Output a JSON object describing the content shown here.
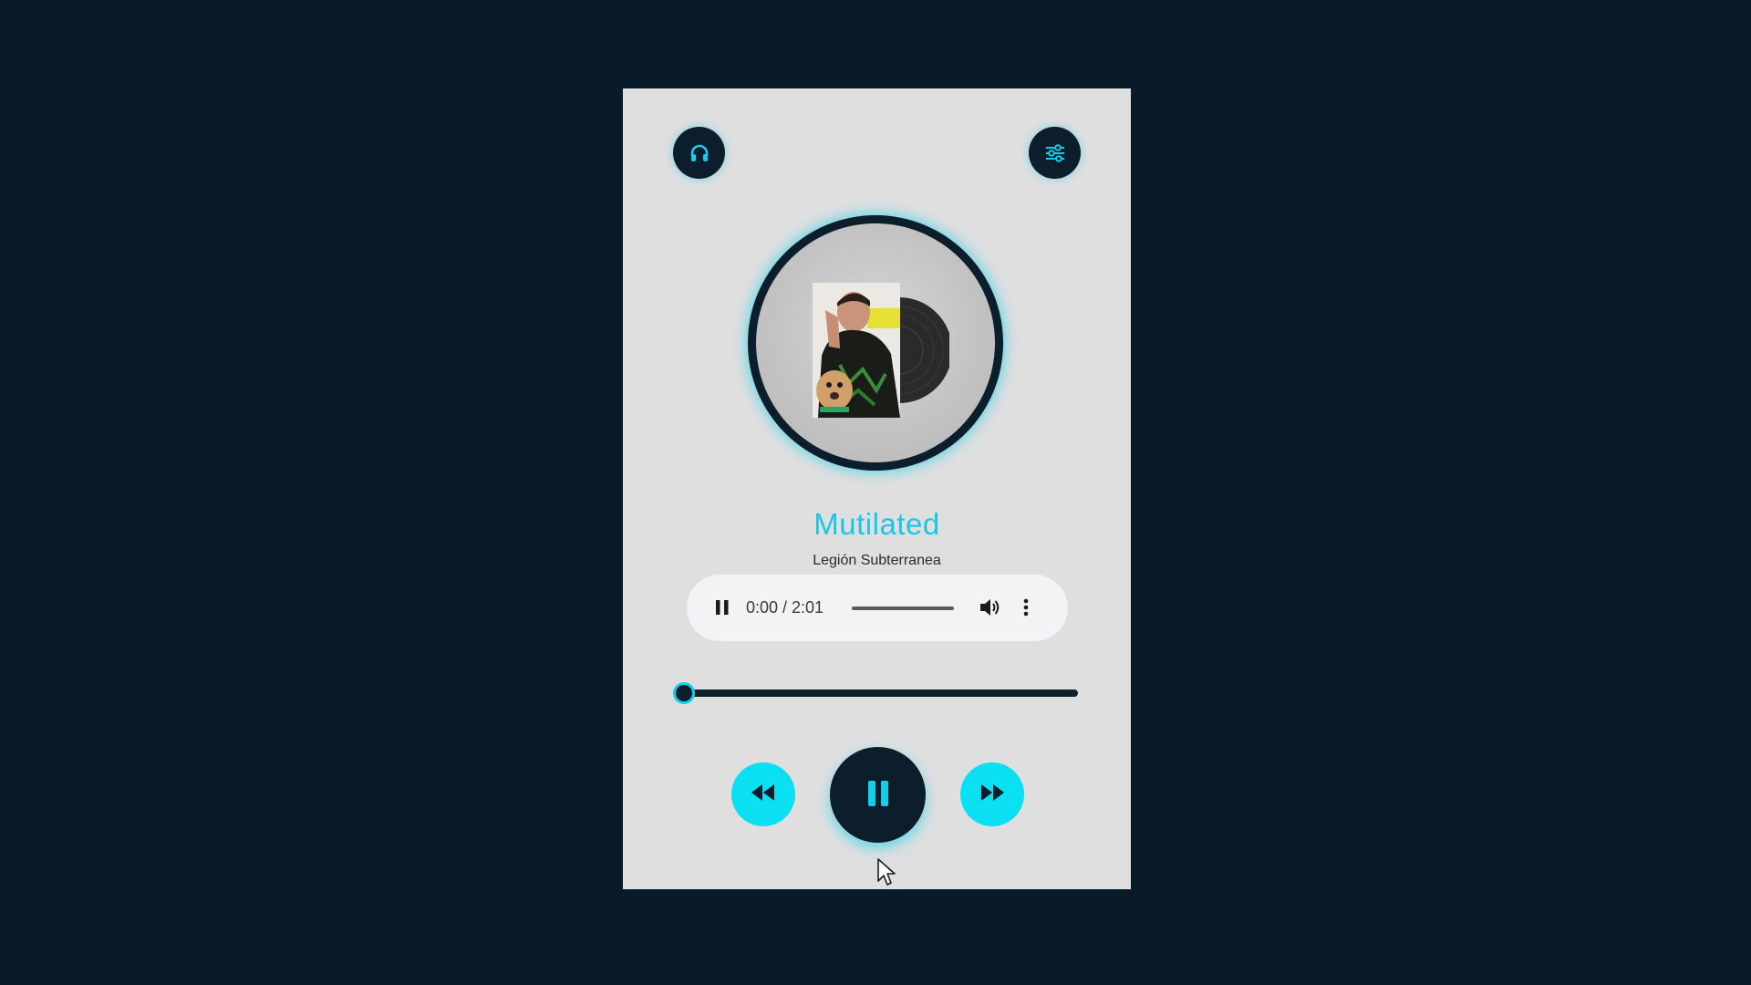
{
  "colors": {
    "page_background": "#091a29",
    "card_background": "#dfdfe0",
    "dark_accent": "#0c1d2b",
    "cyan_accent": "#0bdff2",
    "title_color": "#1ec6e6"
  },
  "header": {
    "left_icon": "headphones-icon",
    "right_icon": "sliders-icon"
  },
  "album": {
    "art_icon": "album-cover-with-vinyl"
  },
  "song": {
    "title": "Mutilated",
    "artist": "Legión Subterranea"
  },
  "audio_element": {
    "time_display": "0:00 / 2:01",
    "play_state_icon": "pause-icon",
    "volume_icon": "volume-icon",
    "more_icon": "more-vertical-icon",
    "progress": 0
  },
  "seek_bar": {
    "progress": 0
  },
  "controls": {
    "prev_icon": "rewind-icon",
    "play_icon": "pause-icon",
    "next_icon": "fast-forward-icon"
  }
}
